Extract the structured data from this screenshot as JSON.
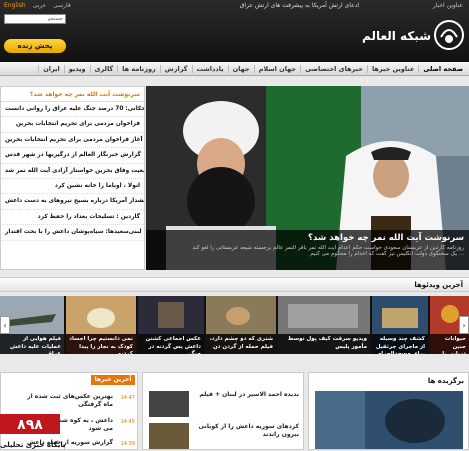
{
  "header": {
    "top_links": [
      "English",
      "فارسی",
      "عربی"
    ],
    "ticker": "ادعای ارتش آمریکا به پیشرفت های ارتش عراق",
    "top_right": "عناوین اخبار",
    "search_placeholder": "جستجو",
    "live_label": "پخش زنده",
    "logo_text": "شبکه العالم"
  },
  "nav": {
    "items": [
      "صفحه اصلی",
      "عناوین خبرها",
      "خبرهای اختصاصی",
      "جهان اسلام",
      "جهان",
      "یادداشت",
      "گزارش",
      "روزنامه ها",
      "گالری",
      "ویدیو",
      "ایران"
    ]
  },
  "feature": {
    "title": "سرنوشت آیت الله نمر چه خواهد شد؟",
    "sub1": "روزنامه گاردین از عربستان سعودی خواست حکم اعدام آیت الله نمر باقر النمر عالم برجسته شیعه عربستانی را لغو کند",
    "sub2": "یک سخنگوی دولت انگلیس نیز گفت که اعدام را محکوم می کنیم ..."
  },
  "news": {
    "header": "سرنوشت آیت الله نمر چه خواهد شد؟",
    "items": [
      "الحکانی: 70 درصد جنگ علیه عراق را روانی دانست",
      "فراخوان مردمی برای تحریم انتخابات بحرین",
      "آغاز فراخوان مردمی برای تحریم انتخابات بحرین",
      "گزارش خبرنگار العالم از درگیریها در شهر قدس",
      "جمعیت وفاق بحرین خواستار آزادی آیت الله نمر شد",
      "انولا ، اوباما را خانه نشین کرد",
      "هشدار آمریکا درباره بسیج نیروهای به دست داعش",
      "گاردین : تسلیحات بغداد را حفظ کرد",
      "لبنی‌سعیدها: سیاه‌پوشان داعش را با بحث اقتدار"
    ]
  },
  "videos": {
    "title": "آخرین ویدئوها",
    "items": [
      "فیلم هوایی از عملیات علیه داعش عراق",
      "نمی دانستیم چرا اجساد کودک به نجار را پیدا کردیم",
      "عکس اجماعی کشتن داعش پس گردنه در جنگ",
      "شتری که دو چشم دارد، فیلم حمله از گردن دن",
      "ویدیو سرقت کیف پول توسط مأمور پلیس",
      "کشف چند وسیله از ماجرای جرثقیل برای مسجدالحرام",
      "حیوانات جنین دریایی با صداهای مختلف در سیستم آواز"
    ]
  },
  "latest": {
    "tab": "آخرین خبرها",
    "items": [
      {
        "time": "14:47",
        "text": "بهترین عکس‌های ثبت شده از ماه گرفتگی"
      },
      {
        "time": "14:45",
        "text": "داعش ، به کوه شنگال نزدیک می شود"
      },
      {
        "time": "14:39",
        "text": "گزارش سوریه از حمله داعش"
      }
    ]
  },
  "mid": {
    "items": [
      "بدیده احمد الاسیر در لبنان + فیلم",
      "کردهای سوریه داعش را از کوبانی بیرون راندند"
    ]
  },
  "selected": {
    "title": "برگزیده ها"
  },
  "watermark": {
    "text": "پایگاه خبری تحلیلی"
  },
  "colors": {
    "accent": "#e8760f",
    "live": "#f2b800"
  }
}
